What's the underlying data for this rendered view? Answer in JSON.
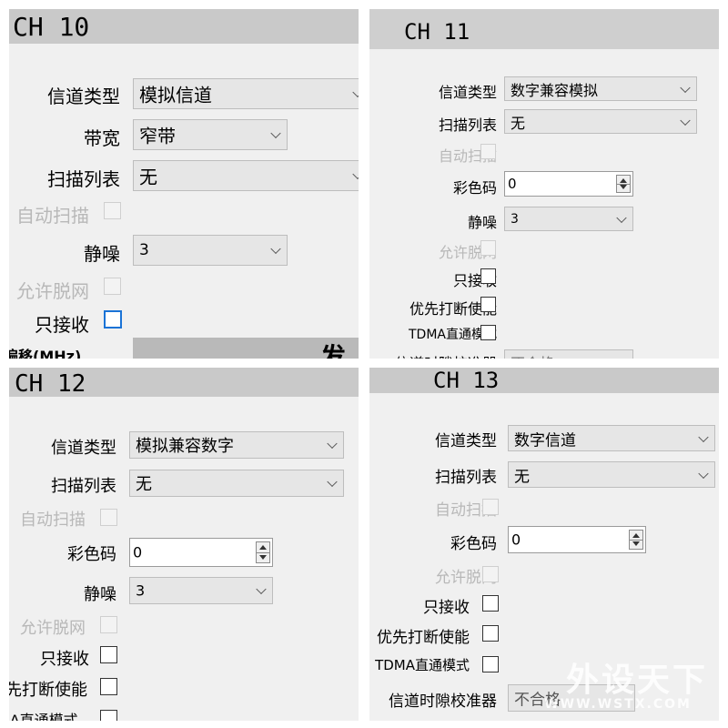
{
  "panels": {
    "ch10": {
      "title": "CH 10",
      "channel_type_label": "信道类型",
      "channel_type_value": "模拟信道",
      "bandwidth_label": "带宽",
      "bandwidth_value": "窄带",
      "scan_list_label": "扫描列表",
      "scan_list_value": "无",
      "auto_scan_label": "自动扫描",
      "squelch_label": "静噪",
      "squelch_value": "3",
      "allow_offnet_label": "允许脱网",
      "rx_only_label": "只接收",
      "offset_label_partial": "偏移(MHz)",
      "right_header_partial": "发射"
    },
    "ch11": {
      "title": "CH 11",
      "channel_type_label": "信道类型",
      "channel_type_value": "数字兼容模拟",
      "scan_list_label": "扫描列表",
      "scan_list_value": "无",
      "auto_scan_label": "自动扫描",
      "color_code_label": "彩色码",
      "color_code_value": "0",
      "squelch_label": "静噪",
      "squelch_value": "3",
      "allow_offnet_label": "允许脱网",
      "rx_only_label": "只接收",
      "priority_interrupt_label": "优先打断使能",
      "tdma_direct_label": "TDMA直通模式",
      "slot_calibrator_label_partial": "信道时隙校准器",
      "slot_calibrator_value_partial": "不合格"
    },
    "ch12": {
      "title": "CH 12",
      "channel_type_label": "信道类型",
      "channel_type_value": "模拟兼容数字",
      "scan_list_label": "扫描列表",
      "scan_list_value": "无",
      "auto_scan_label": "自动扫描",
      "color_code_label": "彩色码",
      "color_code_value": "0",
      "squelch_label": "静噪",
      "squelch_value": "3",
      "allow_offnet_label": "允许脱网",
      "rx_only_label": "只接收",
      "priority_interrupt_label": "先打断使能",
      "tdma_direct_label": "IA直通模式"
    },
    "ch13": {
      "title": "CH 13",
      "channel_type_label": "信道类型",
      "channel_type_value": "数字信道",
      "scan_list_label": "扫描列表",
      "scan_list_value": "无",
      "auto_scan_label": "自动扫描",
      "color_code_label": "彩色码",
      "color_code_value": "0",
      "allow_offnet_label": "允许脱网",
      "rx_only_label": "只接收",
      "priority_interrupt_label": "优先打断使能",
      "tdma_direct_label": "TDMA直通模式",
      "slot_calibrator_label": "信道时隙校准器",
      "slot_calibrator_value": "不合格"
    }
  },
  "watermark": {
    "text": "外设天下",
    "url": "WWW.WSTX.COM"
  },
  "colors": {
    "title_bar": "#c9c9c9",
    "panel_bg": "#f0f0f0",
    "combo_bg": "#e6e6e6",
    "disabled_text": "#b8b8b8",
    "focus_border": "#1a73d6"
  }
}
